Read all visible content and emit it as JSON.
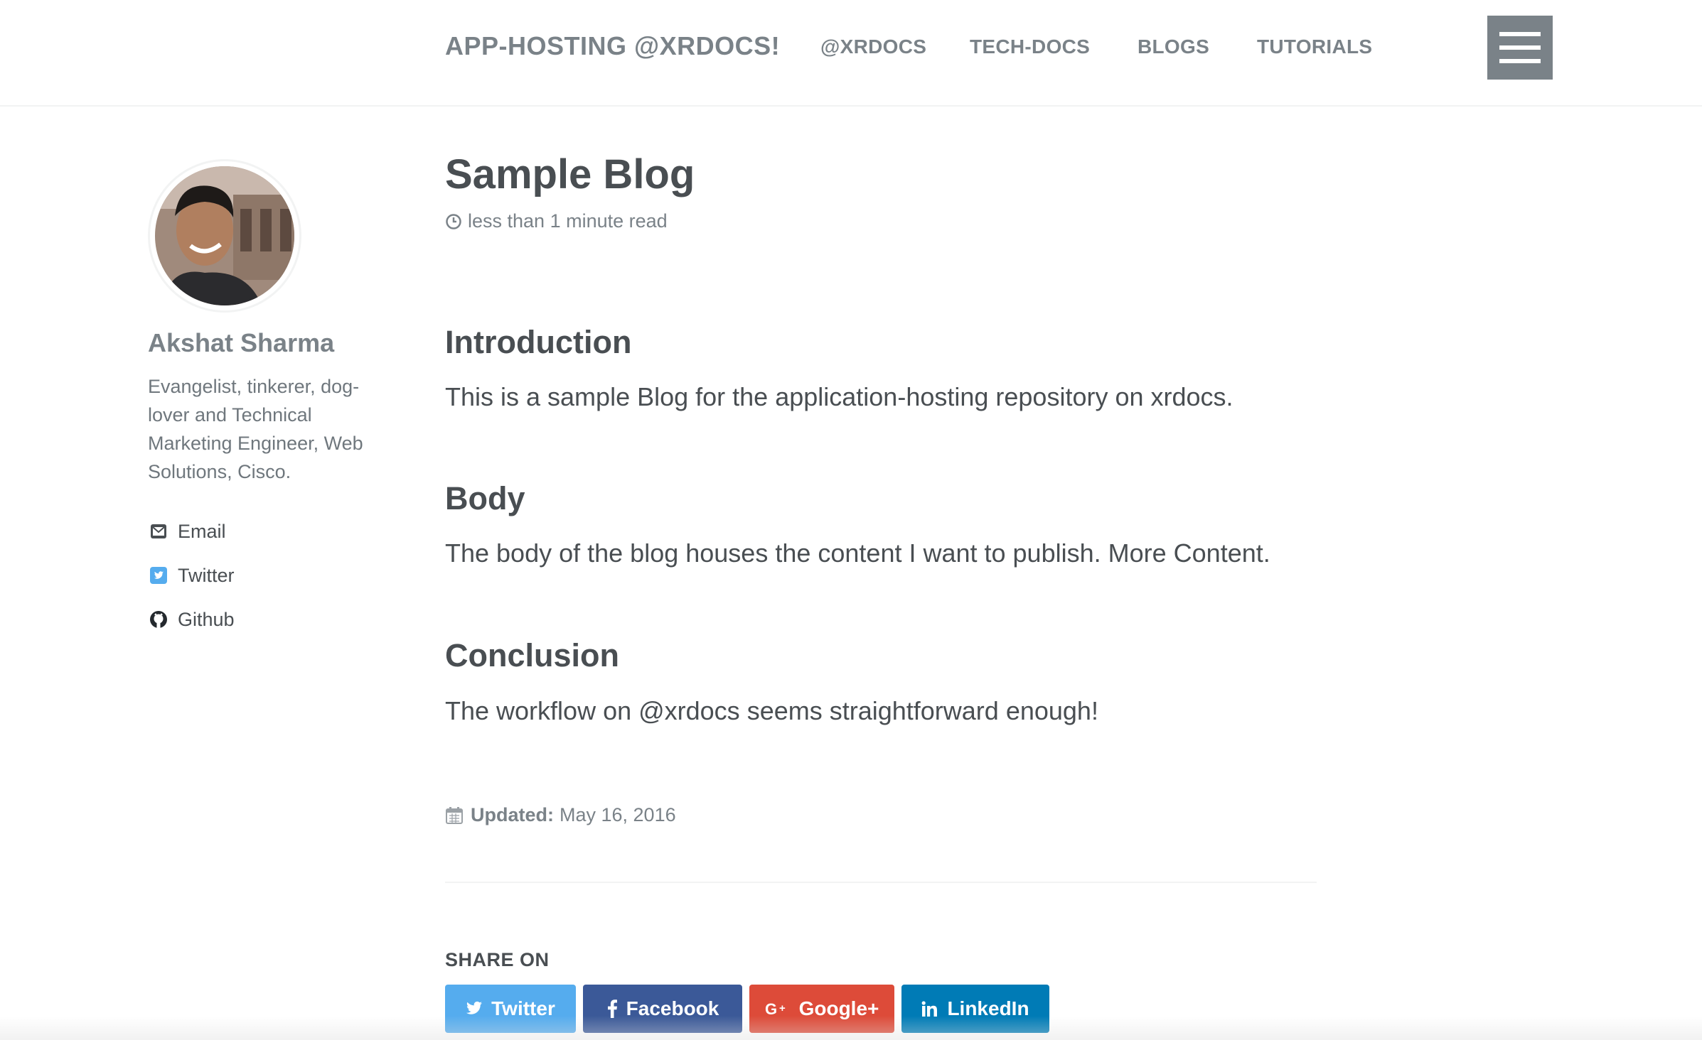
{
  "masthead": {
    "site_title": "APP-HOSTING @XRDOCS!",
    "nav": [
      {
        "label": "@XRDOCS"
      },
      {
        "label": "TECH-DOCS"
      },
      {
        "label": "BLOGS"
      },
      {
        "label": "TUTORIALS"
      }
    ],
    "menu_icon": "hamburger-icon"
  },
  "author": {
    "name": "Akshat Sharma",
    "bio": "Evangelist, tinkerer, dog-lover and Technical Marketing Engineer, Web Solutions, Cisco.",
    "links": [
      {
        "label": "Email",
        "icon": "envelope-icon"
      },
      {
        "label": "Twitter",
        "icon": "twitter-icon"
      },
      {
        "label": "Github",
        "icon": "github-icon"
      }
    ]
  },
  "post": {
    "title": "Sample Blog",
    "read_time": "less than 1 minute read",
    "sections": [
      {
        "heading": "Introduction",
        "body": "This is a sample Blog for the application-hosting repository on xrdocs."
      },
      {
        "heading": "Body",
        "body": "The body of the blog houses the content I want to publish. More Content."
      },
      {
        "heading": "Conclusion",
        "body": "The workflow on @xrdocs seems straightforward enough!"
      }
    ],
    "updated_label": "Updated:",
    "updated_date": "May 16, 2016"
  },
  "share": {
    "heading": "SHARE ON",
    "buttons": [
      {
        "label": "Twitter",
        "color": "#55acee"
      },
      {
        "label": "Facebook",
        "color": "#3b5998"
      },
      {
        "label": "Google+",
        "color": "#dd4b39"
      },
      {
        "label": "LinkedIn",
        "color": "#007bb6"
      }
    ]
  },
  "colors": {
    "text": "#494e52",
    "muted": "#7a8288",
    "menu_bg": "#7a8288"
  }
}
